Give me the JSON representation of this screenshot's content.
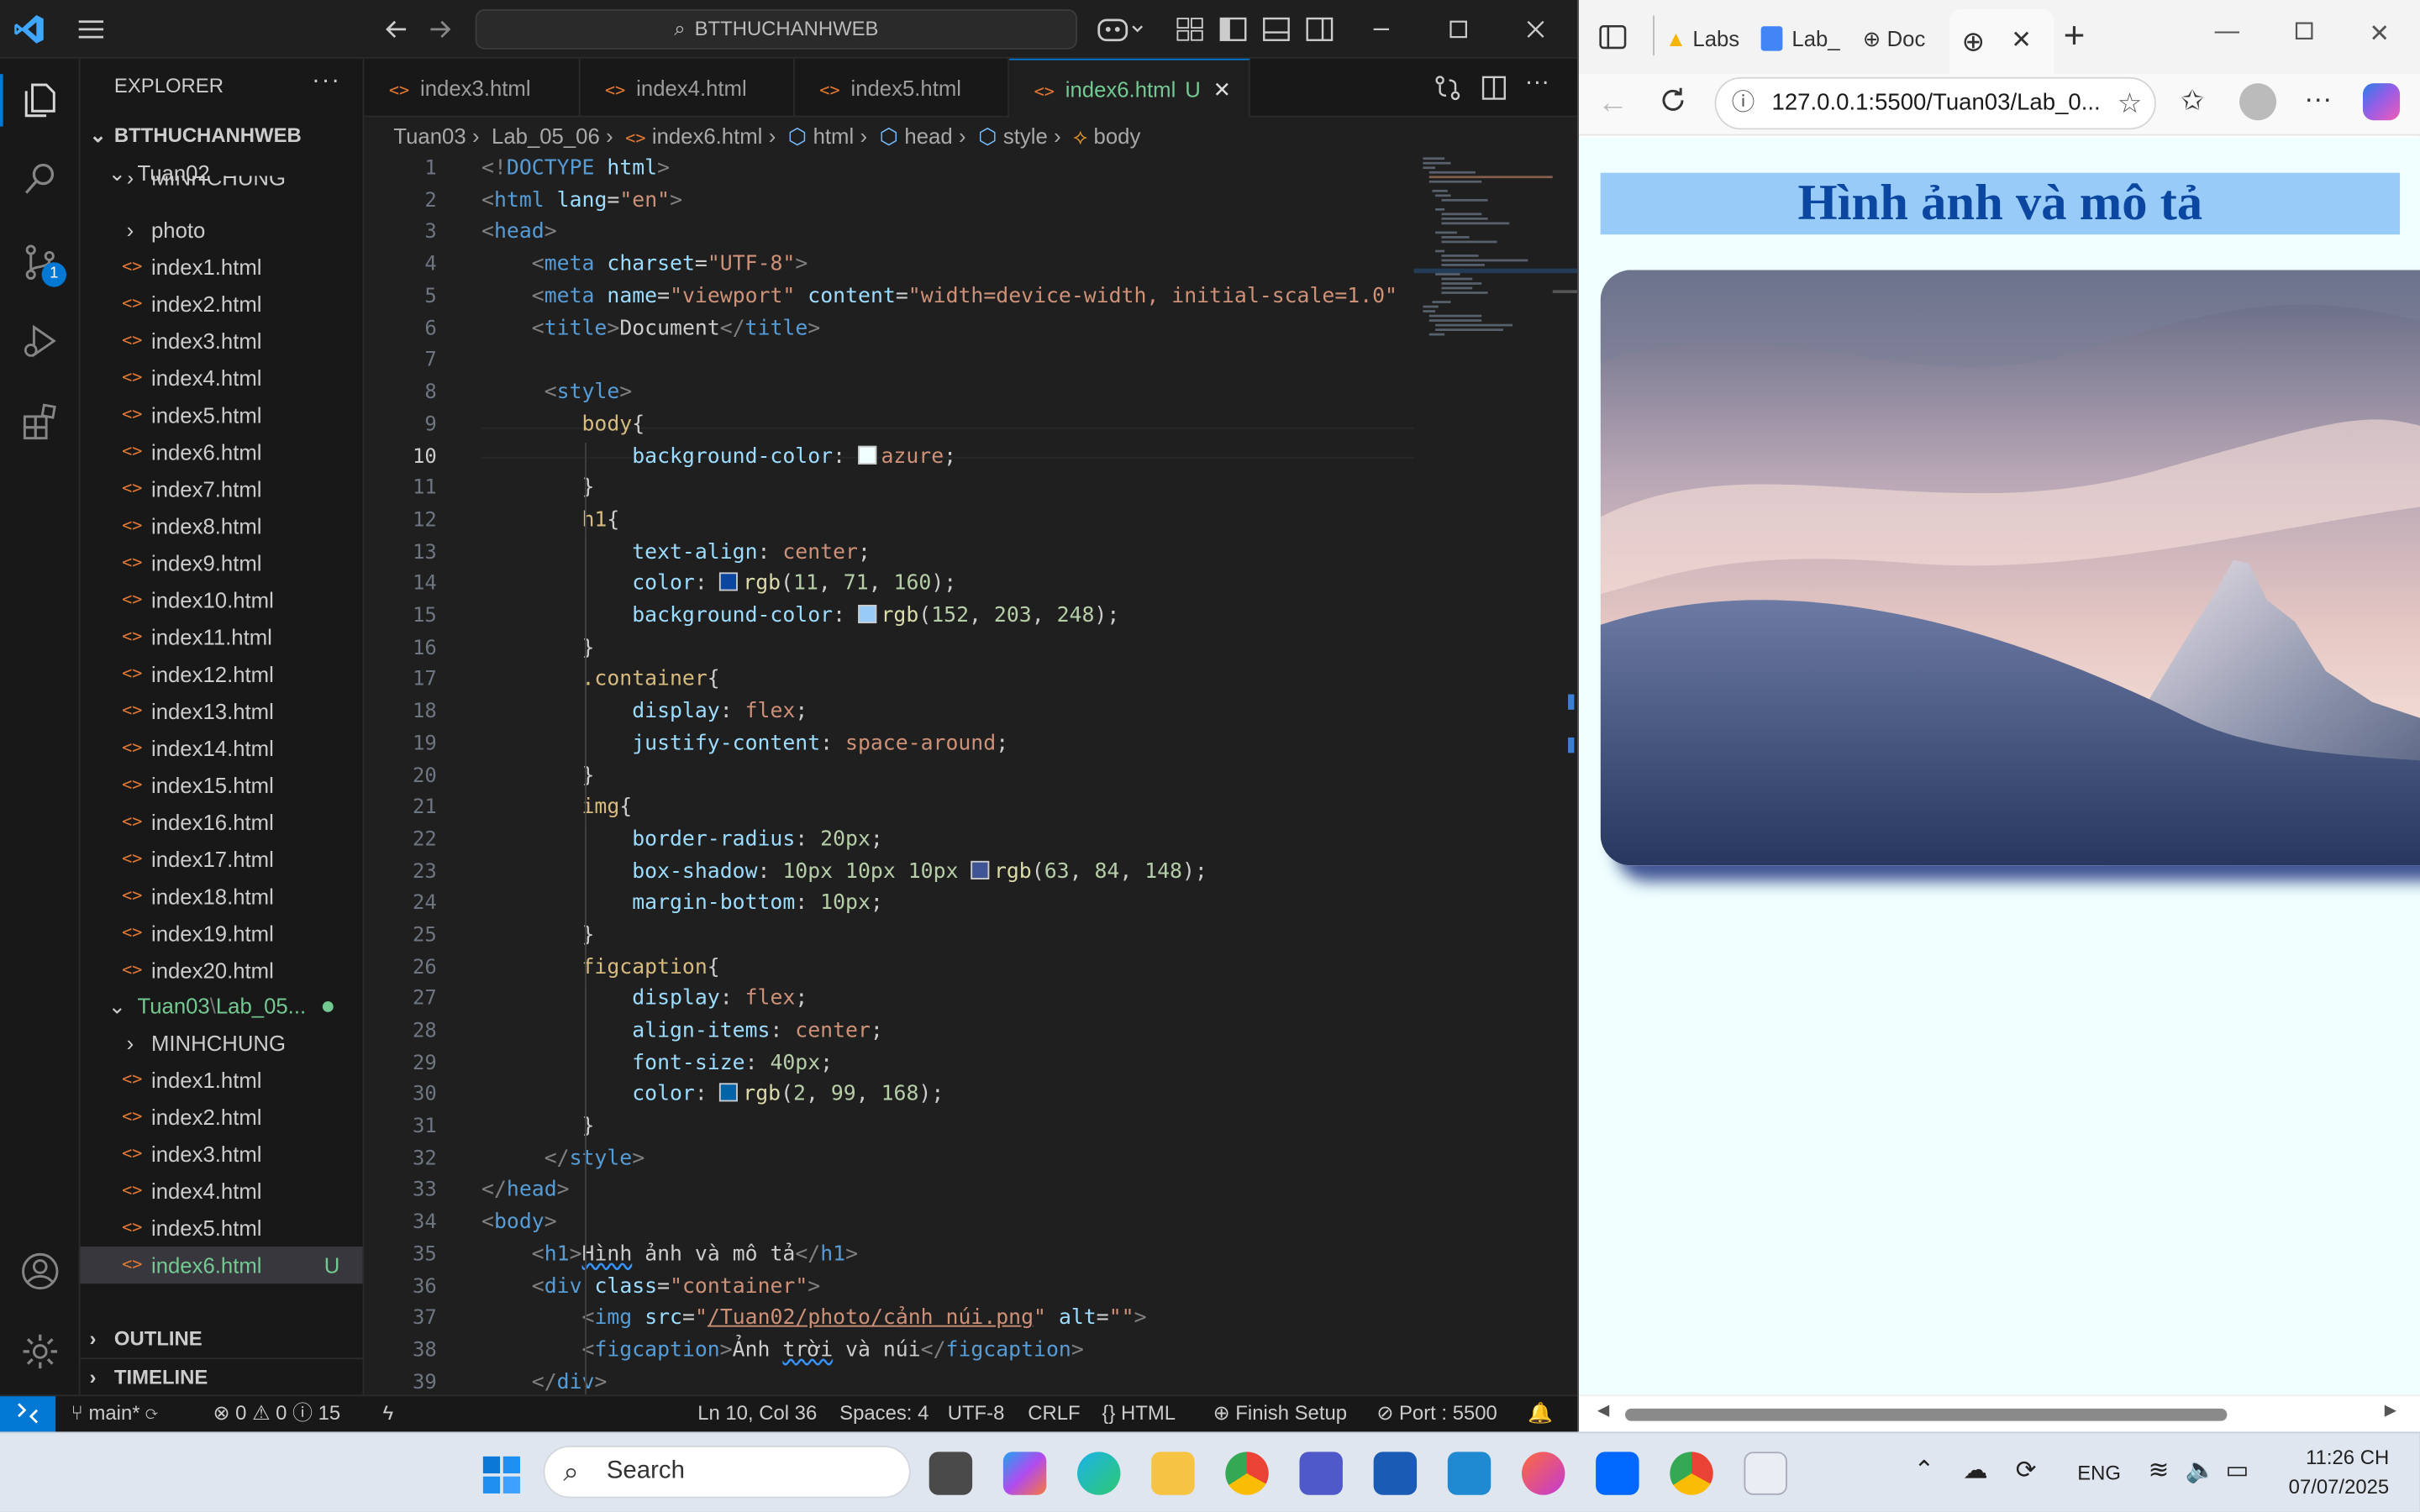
{
  "vscode": {
    "command_center": "BTTHUCHANHWEB",
    "explorer": {
      "title": "EXPLORER",
      "workspace": "BTTHUCHANHWEB",
      "tuan02": {
        "folder": "Tuan02",
        "partial_folder": "MINHCHUNG",
        "photo_folder": "photo",
        "files": [
          "index1.html",
          "index2.html",
          "index3.html",
          "index4.html",
          "index5.html",
          "index6.html",
          "index7.html",
          "index8.html",
          "index9.html",
          "index10.html",
          "index11.html",
          "index12.html",
          "index13.html",
          "index14.html",
          "index15.html",
          "index16.html",
          "index17.html",
          "index18.html",
          "index19.html",
          "index20.html"
        ]
      },
      "tuan03": {
        "folder": "Tuan03",
        "subfolder": "Lab_05...",
        "sep": "\\",
        "minhchung": "MINHCHUNG",
        "files": [
          "index1.html",
          "index2.html",
          "index3.html",
          "index4.html",
          "index5.html",
          "index6.html"
        ],
        "active_badge": "U"
      },
      "outline": "OUTLINE",
      "timeline": "TIMELINE"
    },
    "tabs": [
      {
        "label": "index3.html"
      },
      {
        "label": "index4.html"
      },
      {
        "label": "index5.html"
      },
      {
        "label": "index6.html",
        "badge": "U"
      }
    ],
    "breadcrumb": [
      "Tuan03",
      "Lab_05_06",
      "index6.html",
      "html",
      "head",
      "style",
      "body"
    ],
    "line_numbers": [
      "1",
      "2",
      "3",
      "4",
      "5",
      "6",
      "7",
      "8",
      "9",
      "10",
      "11",
      "12",
      "13",
      "14",
      "15",
      "16",
      "17",
      "18",
      "19",
      "20",
      "21",
      "22",
      "23",
      "24",
      "25",
      "26",
      "27",
      "28",
      "29",
      "30",
      "31",
      "32",
      "33",
      "34",
      "35",
      "36",
      "37",
      "38",
      "39"
    ],
    "current_line": "10",
    "status": {
      "branch": "main*",
      "errors": "0",
      "warnings": "0",
      "info": "0",
      "infos": "15",
      "position": "Ln 10, Col 36",
      "spaces": "Spaces: 4",
      "encoding": "UTF-8",
      "eol": "CRLF",
      "language": "HTML",
      "finish_setup": "Finish Setup",
      "port": "Port : 5500"
    }
  },
  "browser": {
    "tabs": [
      "Labs",
      "Lab_",
      "Doc"
    ],
    "url": "127.0.0.1:5500/Tuan03/Lab_0...",
    "page_heading": "Hình ảnh và mô tả"
  },
  "taskbar": {
    "search": "Search",
    "lang": "ENG",
    "time": "11:26 CH",
    "date": "07/07/2025"
  },
  "colors": {
    "accent": "#0078d4",
    "h1_color": "rgb(11, 71, 160)",
    "h1_bg": "rgb(152, 203, 248)",
    "figcaption": "rgb(2, 99, 168)",
    "shadow": "rgb(63, 84, 148)"
  }
}
